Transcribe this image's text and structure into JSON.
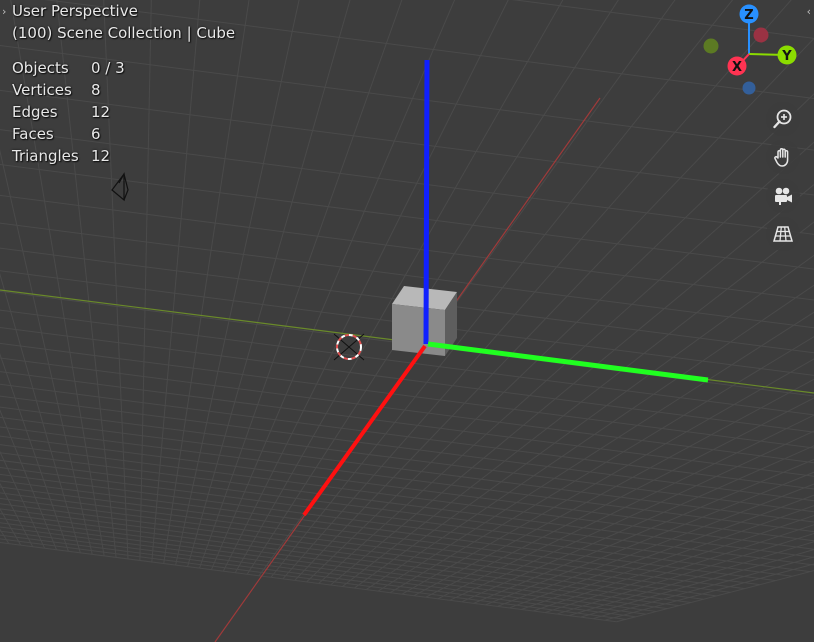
{
  "viewport": {
    "mode_label": "User Perspective",
    "context_label": "(100) Scene Collection | Cube"
  },
  "stats": [
    {
      "label": "Objects",
      "value": "0 / 3"
    },
    {
      "label": "Vertices",
      "value": "8"
    },
    {
      "label": "Edges",
      "value": "12"
    },
    {
      "label": "Faces",
      "value": "6"
    },
    {
      "label": "Triangles",
      "value": "12"
    }
  ],
  "gizmo": {
    "z": "Z",
    "y": "Y",
    "x": "X"
  },
  "nav_buttons": [
    "zoom-icon",
    "hand-icon",
    "camera-icon",
    "grid-icon"
  ],
  "colors": {
    "background": "#3d3d3d",
    "x_axis": "#ff3352",
    "y_axis": "#8bdc00",
    "z_axis": "#2890ff"
  }
}
